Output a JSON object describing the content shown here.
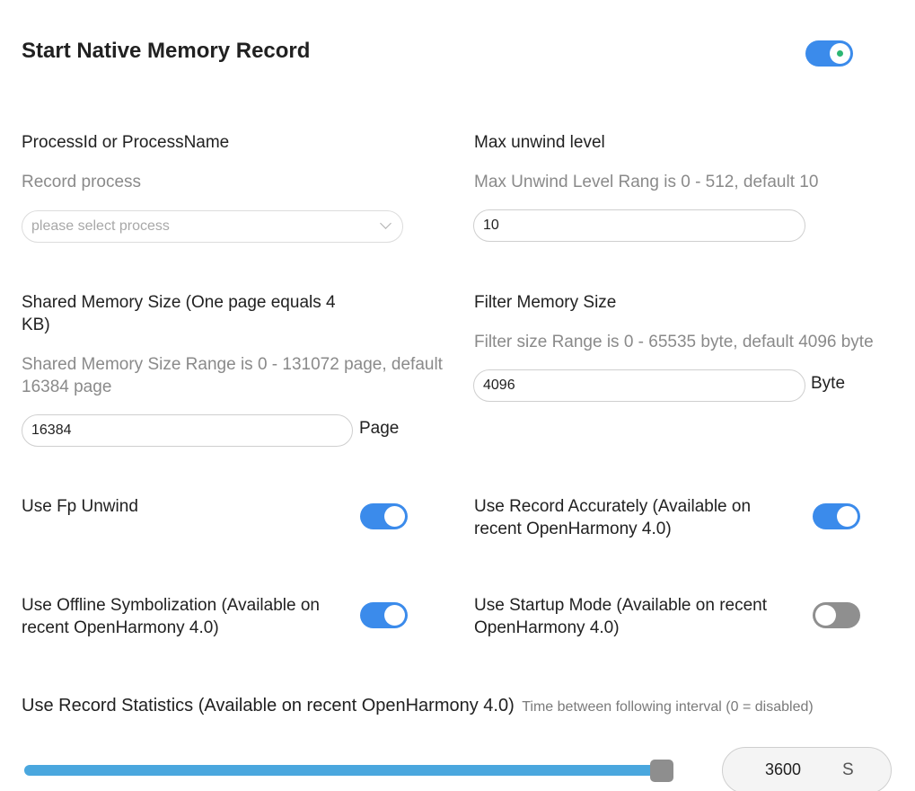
{
  "header": {
    "title": "Start Native Memory Record",
    "record_enabled": true
  },
  "process": {
    "label": "ProcessId or ProcessName",
    "hint": "Record process",
    "placeholder": "please select process"
  },
  "max_unwind": {
    "label": "Max unwind level",
    "hint": "Max Unwind Level Rang is 0 - 512, default 10",
    "value": "10"
  },
  "shared_memory": {
    "label_line1": "Shared Memory Size (One page equals 4",
    "label_line2": "KB)",
    "hint_line1": "Shared Memory Size Range is 0 - 131072 page, default",
    "hint_line2": "16384 page",
    "value": "16384",
    "unit": "Page"
  },
  "filter_memory": {
    "label": "Filter Memory Size",
    "hint": "Filter size Range is 0 - 65535 byte, default 4096 byte",
    "value": "4096",
    "unit": "Byte"
  },
  "options": {
    "fp_unwind": {
      "label": "Use Fp Unwind",
      "enabled": true
    },
    "record_accurately": {
      "label_line1": "Use Record Accurately (Available on",
      "label_line2": "recent OpenHarmony 4.0)",
      "enabled": true
    },
    "offline_symbolization": {
      "label_line1": "Use Offline Symbolization (Available on",
      "label_line2": "recent OpenHarmony 4.0)",
      "enabled": true
    },
    "startup_mode": {
      "label_line1": "Use Startup Mode (Available on recent",
      "label_line2": "OpenHarmony 4.0)",
      "enabled": false
    }
  },
  "statistics": {
    "label": "Use Record Statistics (Available on recent OpenHarmony 4.0)",
    "hint": "Time between following interval (0 = disabled)",
    "slider_fraction": 0.97,
    "value": "3600",
    "unit": "S"
  },
  "colors": {
    "accent": "#3b8beb",
    "slider": "#4aa7de",
    "toggle_off": "#8f8f8f",
    "on_dot": "#2cb673"
  }
}
